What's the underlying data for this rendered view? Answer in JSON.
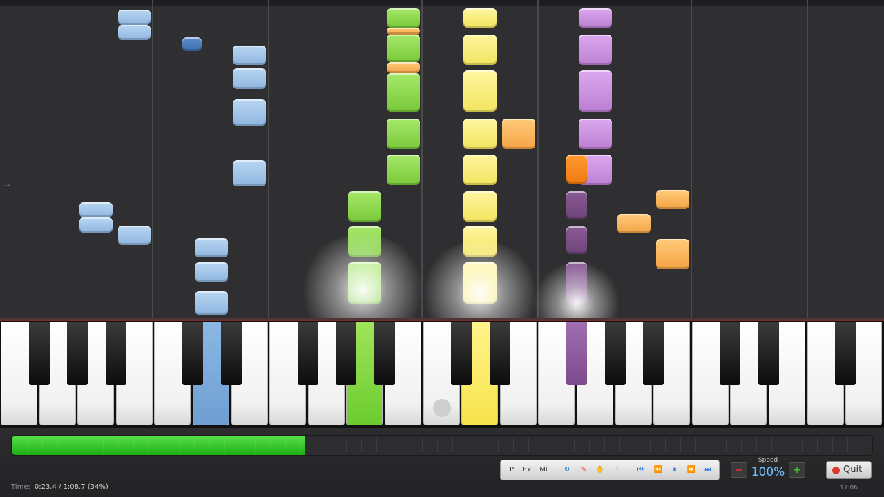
{
  "app": {
    "measure_marker": "12"
  },
  "playback": {
    "progress_fraction": 0.34,
    "time_label": "Time:",
    "time_value": "0:23.4 / 1:08.7 (34%)",
    "clock": "17:06"
  },
  "toolbar": {
    "buttons": [
      {
        "name": "pedal-button",
        "label": "P"
      },
      {
        "name": "ex-button",
        "label": "Ex"
      },
      {
        "name": "mi-button",
        "label": "Mi"
      },
      {
        "name": "loop-icon",
        "label": "↻"
      },
      {
        "name": "pencil-icon",
        "label": "✎"
      },
      {
        "name": "hand-icon",
        "label": "✋"
      },
      {
        "name": "finger-icon",
        "label": "☝"
      },
      {
        "name": "skip-start-icon",
        "label": "⏮"
      },
      {
        "name": "rewind-icon",
        "label": "⏪"
      },
      {
        "name": "pause-icon",
        "label": "⏸"
      },
      {
        "name": "fast-forward-icon",
        "label": "⏩"
      },
      {
        "name": "skip-end-icon",
        "label": "⏭"
      }
    ]
  },
  "speed": {
    "label": "Speed",
    "value": "100%"
  },
  "quit": {
    "label": "Quit"
  },
  "colors": {
    "left_hand": "#8fb6e0",
    "right_hand_green": "#79c93a",
    "right_hand_yellow": "#f2e45f",
    "right_hand_purple": "#bd7fd4",
    "accent_orange": "#f4a444",
    "progress": "#1fae16"
  }
}
